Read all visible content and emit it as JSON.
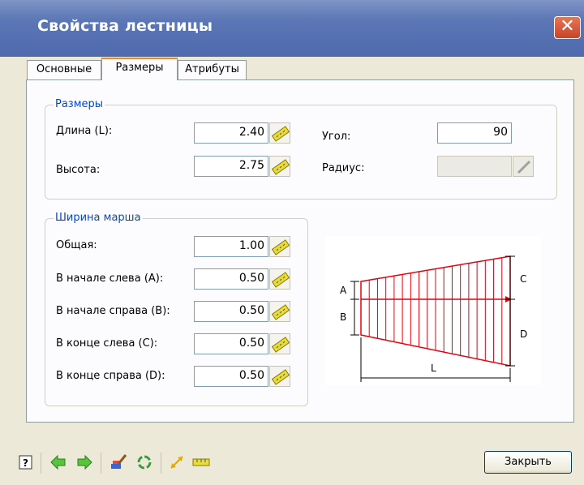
{
  "window": {
    "title": "Свойства лестницы",
    "close_glyph": "✕"
  },
  "tabs": [
    {
      "label": "Основные"
    },
    {
      "label": "Размеры"
    },
    {
      "label": "Атрибуты"
    }
  ],
  "sizes_group": {
    "title": "Размеры",
    "length_label": "Длина (L):",
    "length_value": "2.40",
    "height_label": "Высота:",
    "height_value": "2.75",
    "angle_label": "Угол:",
    "angle_value": "90",
    "radius_label": "Радиус:",
    "radius_value": ""
  },
  "width_group": {
    "title": "Ширина марша",
    "total_label": "Общая:",
    "total_value": "1.00",
    "start_left_label": "В начале слева (A):",
    "start_left_value": "0.50",
    "start_right_label": "В начале справа (B):",
    "start_right_value": "0.50",
    "end_left_label": "В конце слева (C):",
    "end_left_value": "0.50",
    "end_right_label": "В конце справа (D):",
    "end_right_value": "0.50"
  },
  "diagram": {
    "a": "A",
    "b": "B",
    "c": "C",
    "d": "D",
    "l": "L",
    "stair_color": "#e8000e"
  },
  "footer": {
    "close_label": "Закрыть"
  },
  "icons": [
    "help-icon",
    "back-arrow-icon",
    "forward-arrow-icon",
    "paint-brush-icon",
    "refresh-icon",
    "resize-icon",
    "ruler-icon"
  ]
}
